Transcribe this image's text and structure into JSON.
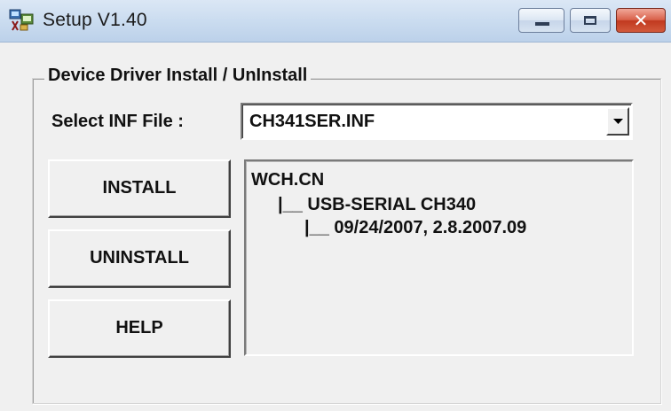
{
  "window": {
    "title": "Setup V1.40",
    "icon": "setup-app-icon",
    "controls": [
      "minimize-icon",
      "maximize-icon",
      "close-icon"
    ]
  },
  "group": {
    "label": "Device Driver Install / UnInstall"
  },
  "inf_select": {
    "label": "Select INF File :",
    "value": "CH341SER.INF"
  },
  "buttons": {
    "install": "INSTALL",
    "uninstall": "UNINSTALL",
    "help": "HELP"
  },
  "info": {
    "lines": [
      "WCH.CN",
      "|__ USB-SERIAL CH340",
      "|__ 09/24/2007, 2.8.2007.09"
    ]
  }
}
